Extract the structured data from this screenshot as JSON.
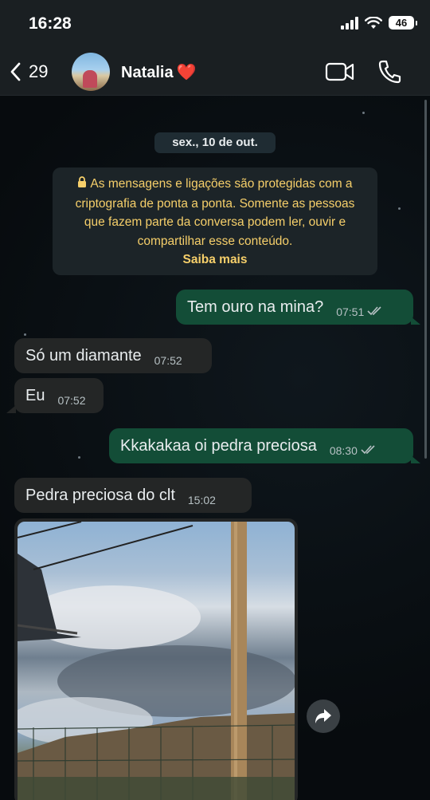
{
  "status_bar": {
    "time": "16:28",
    "battery": "46"
  },
  "header": {
    "back_count": "29",
    "contact_name": "Natalia",
    "contact_emoji": "❤️"
  },
  "chat": {
    "date": "sex., 10 de out.",
    "encryption_notice": {
      "text": "As mensagens e ligações são protegidas com a criptografia de ponta a ponta. Somente as pessoas que fazem parte da conversa podem ler, ouvir e compartilhar esse conteúdo.",
      "link": "Saiba mais"
    },
    "messages": [
      {
        "direction": "out",
        "text": "Tem ouro na mina?",
        "time": "07:51"
      },
      {
        "direction": "in",
        "text": "Só um diamante",
        "time": "07:52"
      },
      {
        "direction": "in",
        "text": "Eu",
        "time": "07:52"
      },
      {
        "direction": "out",
        "text": "Kkakakaa oi pedra preciosa",
        "time": "08:30"
      },
      {
        "direction": "in",
        "text": "Pedra preciosa do clt",
        "time": "15:02"
      }
    ]
  },
  "icons": [
    "back-icon",
    "video-call-icon",
    "phone-call-icon",
    "lock-icon",
    "double-check-icon",
    "forward-icon"
  ],
  "colors": {
    "outgoing_bubble": "#134d37",
    "incoming_bubble": "#242626",
    "notice_text": "#f6cf6a",
    "background": "#0b1014"
  }
}
